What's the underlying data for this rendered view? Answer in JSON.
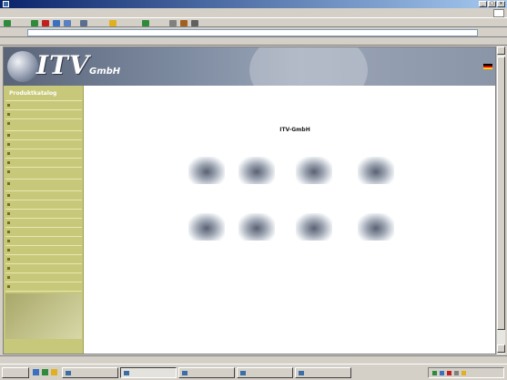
{
  "window": {
    "title": "",
    "buttons": {
      "minimize": "_",
      "maximize": "□",
      "close": "×"
    }
  },
  "menu": {
    "items": [
      "",
      "",
      "",
      "",
      "",
      ""
    ]
  },
  "toolbar": {
    "labels": [
      "",
      "",
      "",
      "",
      ""
    ]
  },
  "address": {
    "label": "",
    "url": "",
    "go": ""
  },
  "links": {
    "label": "",
    "items": [
      "",
      "",
      "",
      ""
    ]
  },
  "banner": {
    "logo_main": "ITV",
    "logo_sub": "GmbH",
    "nav": [
      "",
      "",
      "",
      ""
    ]
  },
  "sidebar": {
    "heading": "Produktkatalog",
    "items": [
      "",
      "",
      "",
      "",
      "",
      "",
      "",
      "",
      "",
      "",
      "",
      "",
      "",
      "",
      "",
      "",
      "",
      "",
      "",
      "",
      "",
      ""
    ]
  },
  "main": {
    "heading": "",
    "subheading": "ITV-GmbH",
    "products": [
      "",
      "",
      "",
      "",
      "",
      "",
      "",
      ""
    ],
    "note": "",
    "address": [
      "",
      "",
      ""
    ]
  },
  "status": {
    "text": "",
    "zone": ""
  },
  "taskbar": {
    "start": "",
    "tasks": [
      "",
      "",
      "",
      "",
      ""
    ],
    "clock": ""
  },
  "colors": {
    "title_bar": "#0a246a",
    "sidebar": "#c8c87a",
    "banner": "#7c8aa0",
    "chrome": "#d4d0c8"
  }
}
